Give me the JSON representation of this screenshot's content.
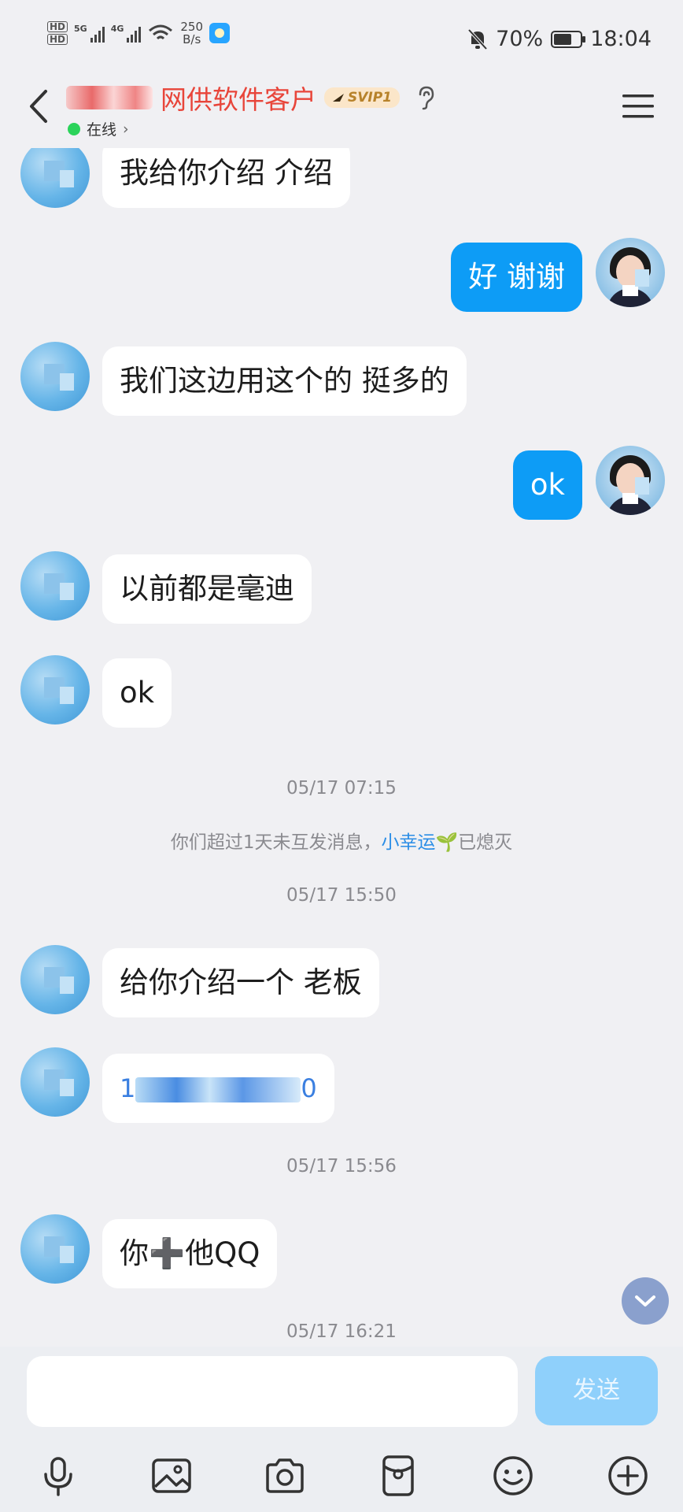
{
  "status_bar": {
    "sim1": "5G",
    "sim2": "4G",
    "net_speed_value": "250",
    "net_speed_unit": "B/s",
    "battery": "70%",
    "battery_level": 0.7,
    "time": "18:04"
  },
  "header": {
    "title": "网供软件客户",
    "vip_badge": "SVIP1",
    "presence": "在线"
  },
  "messages": [
    {
      "from": "contact",
      "text": "我给你介绍 介绍"
    },
    {
      "from": "me",
      "text": "好 谢谢"
    },
    {
      "from": "contact",
      "text": "我们这边用这个的 挺多的"
    },
    {
      "from": "me",
      "text": "ok"
    },
    {
      "from": "contact",
      "text": "以前都是毫迪"
    },
    {
      "from": "contact",
      "text": "ok"
    },
    {
      "timestamp": "05/17 07:15"
    },
    {
      "system_prefix": "你们超过1天未互发消息，",
      "system_link": "小幸运",
      "system_suffix": "已熄灭"
    },
    {
      "timestamp": "05/17 15:50"
    },
    {
      "from": "contact",
      "text": "给你介绍一个 老板"
    },
    {
      "from": "contact",
      "text": "1",
      "text2": "0"
    },
    {
      "timestamp": "05/17 15:56"
    },
    {
      "from": "contact",
      "text": "你➕他QQ"
    },
    {
      "timestamp": "05/17 16:21"
    }
  ],
  "composer": {
    "input_value": "",
    "send_label": "发送"
  },
  "icons": [
    "back-icon",
    "ear-icon",
    "menu-icon",
    "mic-icon",
    "image-icon",
    "camera-icon",
    "red-packet-icon",
    "emoji-icon",
    "plus-icon",
    "chevron-down-icon"
  ]
}
